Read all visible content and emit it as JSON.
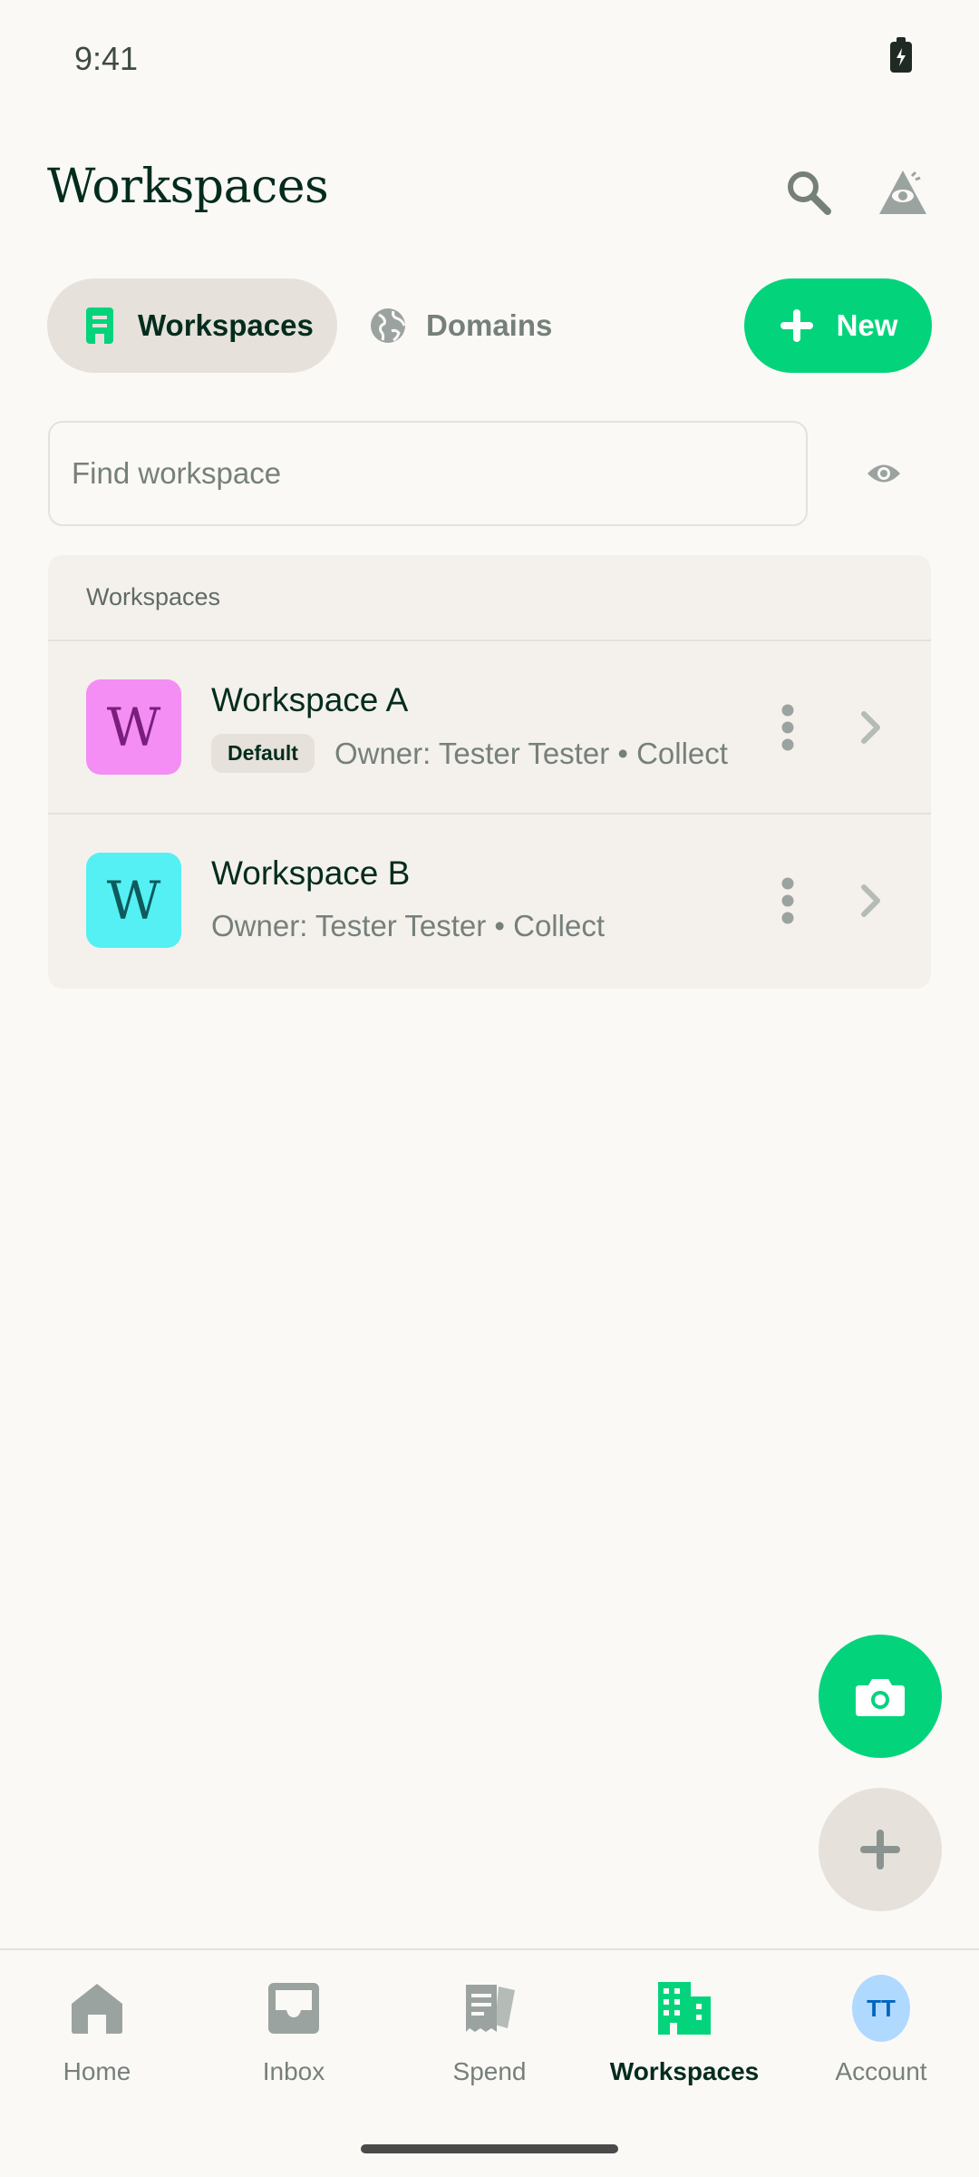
{
  "status_bar": {
    "time": "9:41"
  },
  "header": {
    "title": "Workspaces"
  },
  "tabs": [
    {
      "label": "Workspaces",
      "active": true,
      "icon": "workspace-list-icon"
    },
    {
      "label": "Domains",
      "active": false,
      "icon": "globe-icon"
    }
  ],
  "new_button": {
    "label": "New"
  },
  "search": {
    "placeholder": "Find workspace"
  },
  "list": {
    "header": "Workspaces",
    "items": [
      {
        "initial": "W",
        "name": "Workspace A",
        "badge": "Default",
        "subtitle": "Owner: Tester Tester • Collect",
        "avatar_bg": "#F48DF4",
        "avatar_fg": "#7A1E7E"
      },
      {
        "initial": "W",
        "name": "Workspace B",
        "badge": "",
        "subtitle": "Owner: Tester Tester • Collect",
        "avatar_bg": "#54F0F4",
        "avatar_fg": "#0E5A5C"
      }
    ]
  },
  "bottom_nav": [
    {
      "label": "Home",
      "icon": "home-icon",
      "active": false
    },
    {
      "label": "Inbox",
      "icon": "inbox-icon",
      "active": false
    },
    {
      "label": "Spend",
      "icon": "receipt-icon",
      "active": false
    },
    {
      "label": "Workspaces",
      "icon": "building-icon",
      "active": true
    },
    {
      "label": "Account",
      "icon": "avatar",
      "initials": "TT",
      "active": false
    }
  ],
  "colors": {
    "accent": "#03D47C",
    "text": "#032C1E",
    "muted": "#76807B",
    "background": "#FBF9F6"
  }
}
